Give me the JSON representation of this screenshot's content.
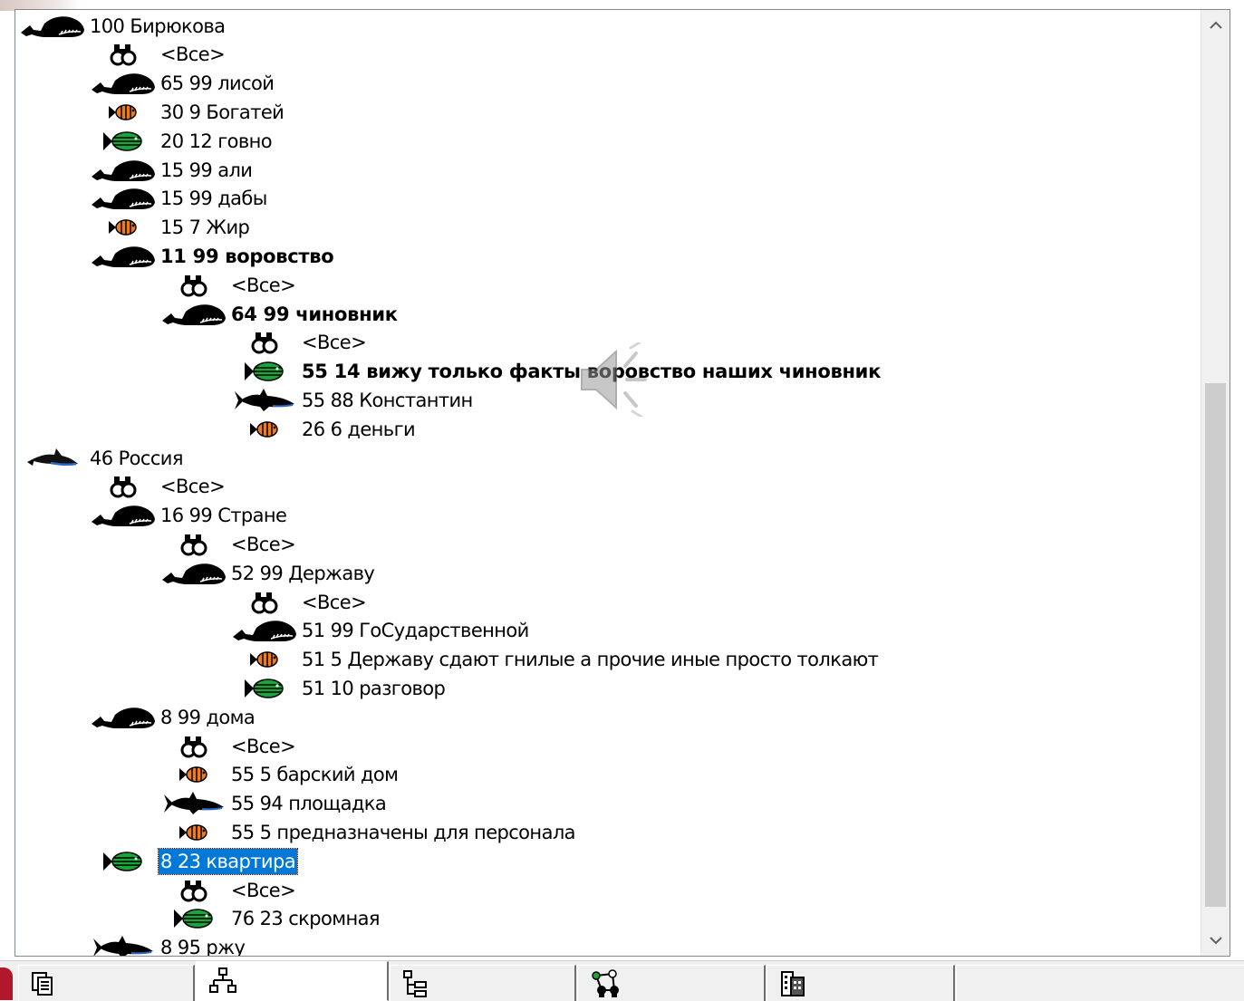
{
  "window": {
    "selected_item": "8 23 квартира"
  },
  "tree": {
    "items": [
      {
        "level": 0,
        "icon": "whale-icon",
        "label": "100 Бирюкова",
        "bold": false
      },
      {
        "level": 1,
        "icon": "binoculars-icon",
        "label": "<Все>",
        "bold": false
      },
      {
        "level": 1,
        "icon": "whale-icon",
        "label": "65 99 лисой",
        "bold": false
      },
      {
        "level": 1,
        "icon": "orange-fish-icon",
        "label": "30 9 Богатей",
        "bold": false
      },
      {
        "level": 1,
        "icon": "green-fish-icon",
        "label": "20 12 говно",
        "bold": false
      },
      {
        "level": 1,
        "icon": "whale-icon",
        "label": "15 99 али",
        "bold": false
      },
      {
        "level": 1,
        "icon": "whale-icon",
        "label": "15 99 дабы",
        "bold": false
      },
      {
        "level": 1,
        "icon": "orange-fish-icon",
        "label": "15 7 Жир",
        "bold": false
      },
      {
        "level": 1,
        "icon": "whale-icon",
        "label": "11 99 воровство",
        "bold": true
      },
      {
        "level": 2,
        "icon": "binoculars-icon",
        "label": "<Все>",
        "bold": false
      },
      {
        "level": 2,
        "icon": "whale-icon",
        "label": "64 99 чиновник",
        "bold": true
      },
      {
        "level": 3,
        "icon": "binoculars-icon",
        "label": "<Все>",
        "bold": false
      },
      {
        "level": 3,
        "icon": "green-fish-icon",
        "label": "55 14 вижу только факты воровство наших чиновник",
        "bold": true
      },
      {
        "level": 3,
        "icon": "shark-icon",
        "label": "55 88 Константин",
        "bold": false
      },
      {
        "level": 3,
        "icon": "orange-fish-icon",
        "label": "26 6 деньги",
        "bold": false
      },
      {
        "level": 0,
        "icon": "dolphin-icon",
        "label": "46 Россия",
        "bold": false
      },
      {
        "level": 1,
        "icon": "binoculars-icon",
        "label": "<Все>",
        "bold": false
      },
      {
        "level": 1,
        "icon": "whale-icon",
        "label": "16 99 Стране",
        "bold": false
      },
      {
        "level": 2,
        "icon": "binoculars-icon",
        "label": "<Все>",
        "bold": false
      },
      {
        "level": 2,
        "icon": "whale-icon",
        "label": "52 99 Державу",
        "bold": false
      },
      {
        "level": 3,
        "icon": "binoculars-icon",
        "label": "<Все>",
        "bold": false
      },
      {
        "level": 3,
        "icon": "whale-icon",
        "label": "51 99 ГоСударственной",
        "bold": false
      },
      {
        "level": 3,
        "icon": "orange-fish-icon",
        "label": "51 5 Державу сдают гнилые а прочие иные просто толкают",
        "bold": false
      },
      {
        "level": 3,
        "icon": "green-fish-icon",
        "label": "51 10 разговор",
        "bold": false
      },
      {
        "level": 1,
        "icon": "whale-icon",
        "label": "8 99 дома",
        "bold": false
      },
      {
        "level": 2,
        "icon": "binoculars-icon",
        "label": "<Все>",
        "bold": false
      },
      {
        "level": 2,
        "icon": "orange-fish-icon",
        "label": "55 5 барский дом",
        "bold": false
      },
      {
        "level": 2,
        "icon": "shark-icon",
        "label": "55 94 площадка",
        "bold": false
      },
      {
        "level": 2,
        "icon": "orange-fish-icon",
        "label": "55 5 предназначены для персонала",
        "bold": false
      },
      {
        "level": 1,
        "icon": "green-fish-icon",
        "label": "8 23 квартира",
        "bold": false,
        "selected": true
      },
      {
        "level": 2,
        "icon": "binoculars-icon",
        "label": "<Все>",
        "bold": false
      },
      {
        "level": 2,
        "icon": "green-fish-icon",
        "label": "76 23 скромная",
        "bold": false
      },
      {
        "level": 1,
        "icon": "shark-icon",
        "label": "8 95 ржу",
        "bold": false
      }
    ]
  },
  "tabs": [
    {
      "icon": "pages-icon",
      "active": false
    },
    {
      "icon": "hierarchy-icon",
      "active": true
    },
    {
      "icon": "tree-outline-icon",
      "active": false
    },
    {
      "icon": "network-icon",
      "active": false
    },
    {
      "icon": "building-icon",
      "active": false
    },
    {
      "icon": "blank",
      "active": false
    }
  ],
  "colors": {
    "selection": "#0078d7",
    "orange_fish": "#f07d14",
    "green_fish": "#1aa53a",
    "scroll_thumb": "#cdcdcd"
  }
}
